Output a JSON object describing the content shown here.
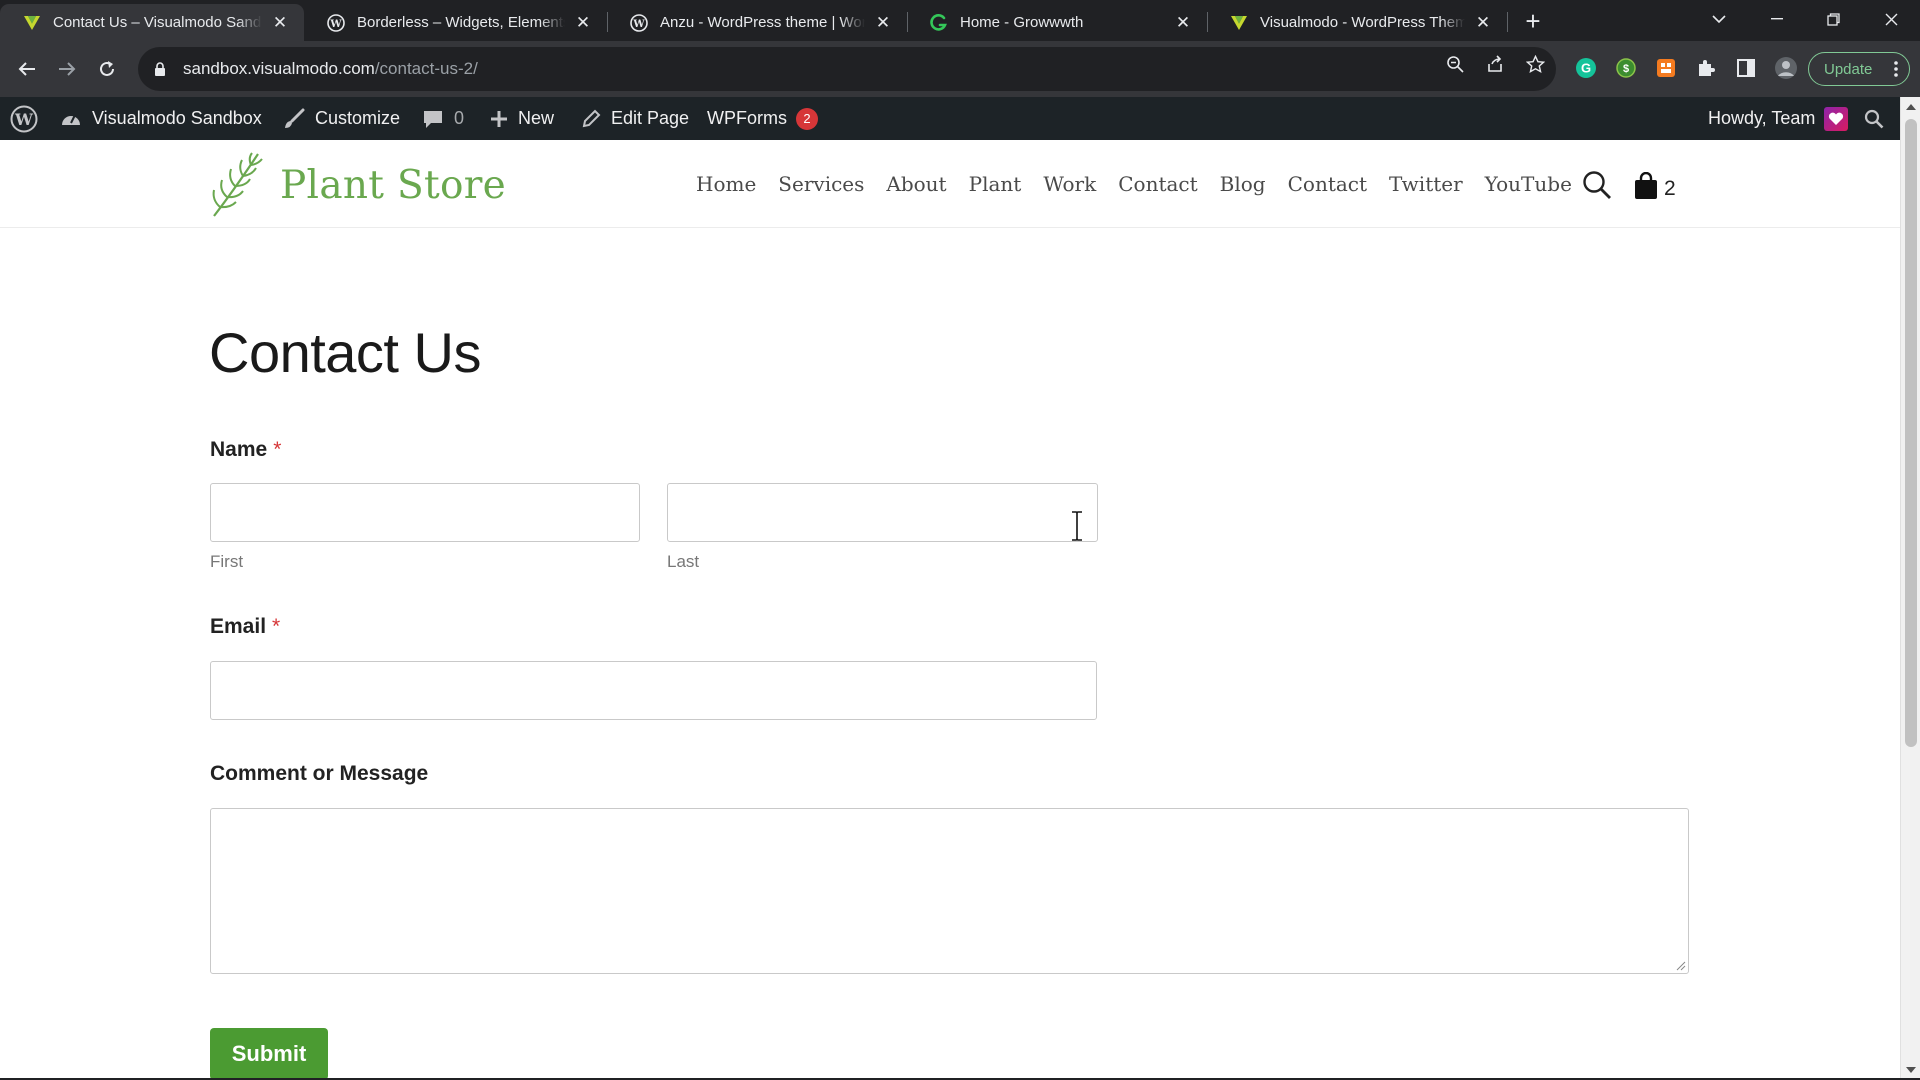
{
  "browser": {
    "tabs": [
      {
        "title": "Contact Us – Visualmodo Sandbox",
        "icon": "visualmodo-favicon",
        "active": true
      },
      {
        "title": "Borderless – Widgets, Elements, Templates",
        "icon": "wordpress-favicon",
        "active": false
      },
      {
        "title": "Anzu - WordPress theme | WordPress",
        "icon": "wordpress-favicon",
        "active": false
      },
      {
        "title": "Home - Growwwth",
        "icon": "growwwth-favicon",
        "active": false
      },
      {
        "title": "Visualmodo - WordPress Themes",
        "icon": "visualmodo-favicon",
        "active": false
      }
    ],
    "url_host": "sandbox.visualmodo.com",
    "url_path": "/contact-us-2/",
    "update_label": "Update"
  },
  "adminbar": {
    "site_name": "Visualmodo Sandbox",
    "customize": "Customize",
    "comments_count": "0",
    "new_label": "New",
    "edit_page": "Edit Page",
    "wpforms": "WPForms",
    "wpforms_badge": "2",
    "howdy": "Howdy, Team"
  },
  "site": {
    "logo_text": "Plant Store",
    "nav": [
      "Home",
      "Services",
      "About",
      "Plant",
      "Work",
      "Contact",
      "Blog",
      "Contact",
      "Twitter",
      "YouTube"
    ],
    "cart_count": "2",
    "brand_color": "#6aa84f"
  },
  "page": {
    "title": "Contact Us",
    "form": {
      "name_label": "Name",
      "required_mark": "*",
      "first_sublabel": "First",
      "last_sublabel": "Last",
      "email_label": "Email",
      "message_label": "Comment or Message",
      "submit_label": "Submit",
      "submit_color": "#4b9b32"
    }
  }
}
